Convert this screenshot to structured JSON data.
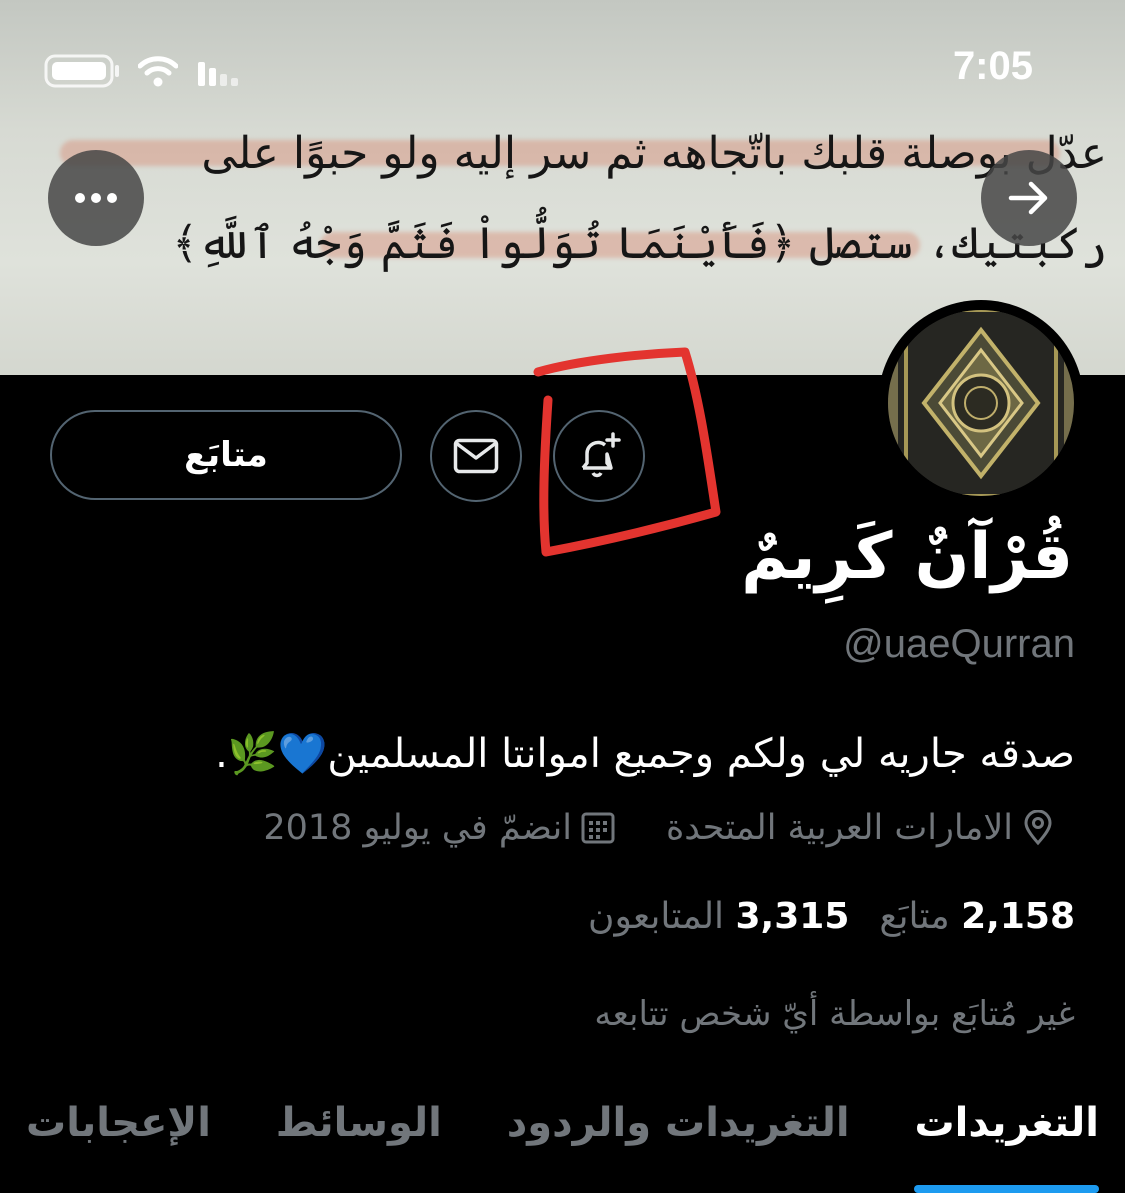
{
  "status_bar": {
    "time": "7:05"
  },
  "banner": {
    "line1": "عدّل بوصلة قلبك باتّجاهه ثم سر إليه ولو حبوًا على",
    "line2": "ركبتيك، ستصل ﴿فَأَيْنَمَا تُوَلُّواْ فَثَمَّ وَجْهُ ٱللَّهِ﴾"
  },
  "actions": {
    "follow_label": "متابَع",
    "message_icon": "mail-icon",
    "notify_icon": "bell-plus-icon",
    "more_icon": "more-icon",
    "share_icon": "arrow-right-icon",
    "annotation_color": "#e3342f"
  },
  "profile": {
    "display_name": "قُرْآنٌ كَرِيمٌ",
    "handle": "@uaeQurran",
    "bio": "صدقه جاريه لي ولكم وجميع اموانتا المسلمين💙🌿.",
    "location": "الامارات العربية المتحدة",
    "joined": "انضمّ في يوليو 2018"
  },
  "stats": {
    "following_count": "2,158",
    "following_label": "متابَع",
    "followers_count": "3,315",
    "followers_label": "المتابعون"
  },
  "not_followed_text": "غير مُتابَع بواسطة أيّ شخص تتابعه",
  "tabs": [
    {
      "label": "التغريدات",
      "active": true
    },
    {
      "label": "التغريدات والردود",
      "active": false
    },
    {
      "label": "الوسائط",
      "active": false
    },
    {
      "label": "الإعجابات",
      "active": false
    }
  ],
  "colors": {
    "accent": "#1d9bf0",
    "muted": "#71767b",
    "background": "#000000"
  }
}
